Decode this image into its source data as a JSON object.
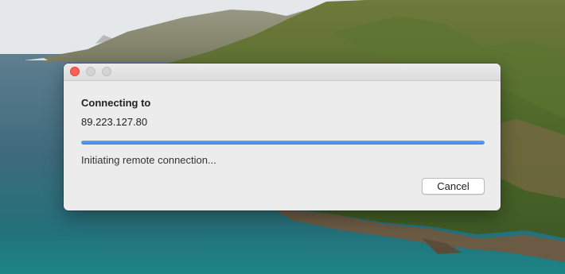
{
  "dialog": {
    "heading": "Connecting to",
    "address": "89.223.127.80",
    "progress_fraction": 1.0,
    "status": "Initiating remote connection...",
    "cancel_label": "Cancel"
  },
  "colors": {
    "close_button": "#fc5f57",
    "inactive_button": "#d4d4d4",
    "progress": "#3d87ee"
  }
}
